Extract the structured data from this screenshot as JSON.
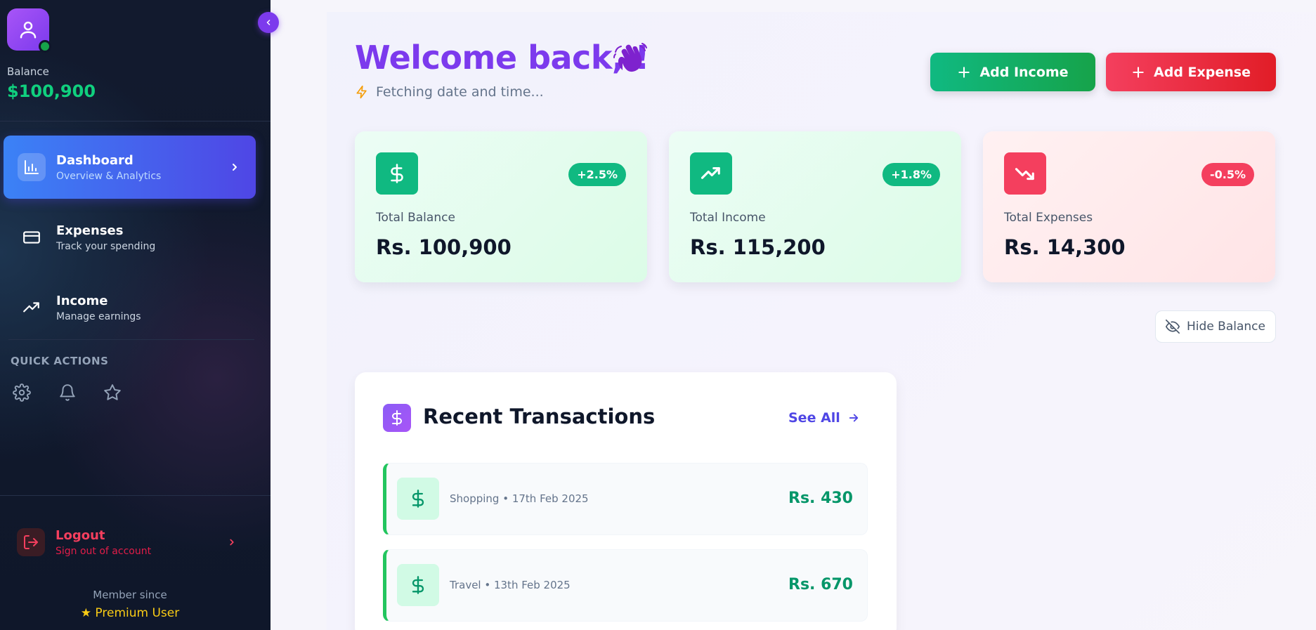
{
  "sidebar": {
    "balance_label": "Balance",
    "balance_value": "$100,900",
    "nav": [
      {
        "title": "Dashboard",
        "subtitle": "Overview & Analytics",
        "icon": "bar-chart-icon",
        "active": true
      },
      {
        "title": "Expenses",
        "subtitle": "Track your spending",
        "icon": "credit-card-icon",
        "active": false
      },
      {
        "title": "Income",
        "subtitle": "Manage earnings",
        "icon": "trending-up-icon",
        "active": false
      }
    ],
    "quick_actions_label": "QUICK ACTIONS",
    "quick_actions": [
      "settings-icon",
      "bell-icon",
      "star-icon"
    ],
    "logout": {
      "title": "Logout",
      "subtitle": "Sign out of account"
    },
    "member_since": "Member since",
    "premium_label": "Premium User"
  },
  "header": {
    "welcome": "Welcome back, !",
    "datetime": "Fetching date and time...",
    "add_income": "Add Income",
    "add_expense": "Add Expense"
  },
  "stats": [
    {
      "label": "Total Balance",
      "value": "Rs. 100,900",
      "change": "+2.5%",
      "icon": "dollar-icon",
      "tone": "green"
    },
    {
      "label": "Total Income",
      "value": "Rs. 115,200",
      "change": "+1.8%",
      "icon": "trending-up-icon",
      "tone": "green"
    },
    {
      "label": "Total Expenses",
      "value": "Rs. 14,300",
      "change": "-0.5%",
      "icon": "trending-down-icon",
      "tone": "red"
    }
  ],
  "hide_balance": "Hide Balance",
  "transactions": {
    "title": "Recent Transactions",
    "see_all": "See All",
    "items": [
      {
        "description": "Shopping • 17th Feb 2025",
        "amount": "Rs. 430"
      },
      {
        "description": "Travel • 13th Feb 2025",
        "amount": "Rs. 670"
      }
    ]
  },
  "colors": {
    "accent": "#7c3aed",
    "income": "#10b981",
    "expense": "#f43f5e",
    "primary_blue": "#4f46e5"
  }
}
